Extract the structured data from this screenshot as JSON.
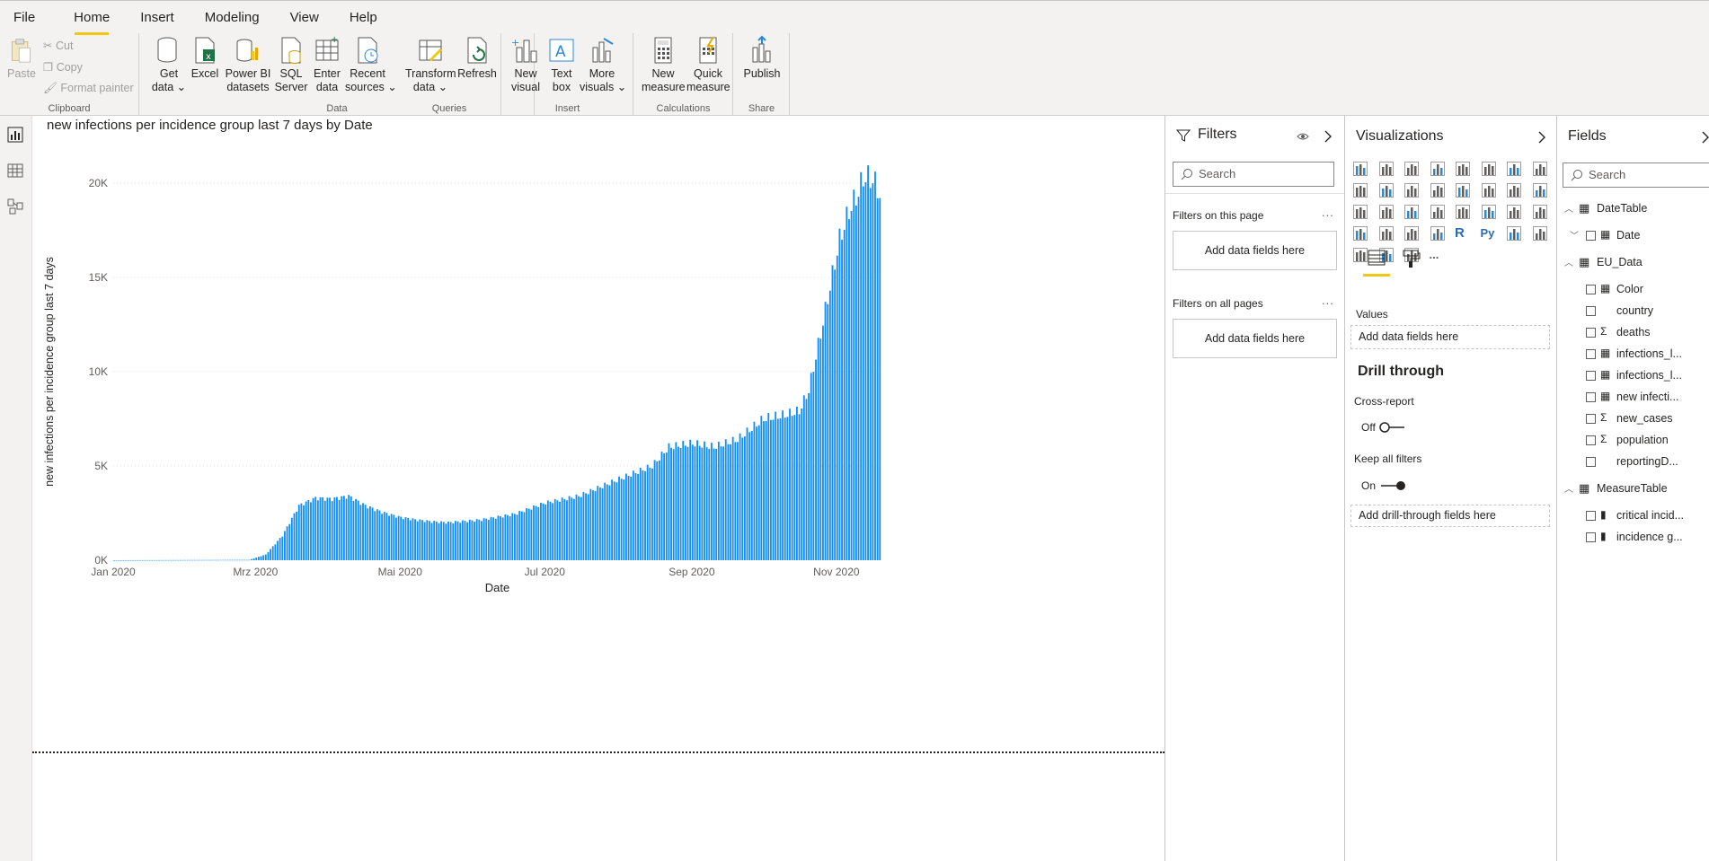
{
  "ribbon": {
    "tabs": [
      "File",
      "Home",
      "Insert",
      "Modeling",
      "View",
      "Help"
    ],
    "active_tab": "Home",
    "clipboard": {
      "paste": "Paste",
      "cut": "Cut",
      "copy": "Copy",
      "format_painter": "Format painter",
      "group": "Clipboard"
    },
    "data": {
      "get_data": [
        "Get",
        "data"
      ],
      "excel": [
        "Excel",
        ""
      ],
      "pbi_datasets": [
        "Power BI",
        "datasets"
      ],
      "sql_server": [
        "SQL",
        "Server"
      ],
      "enter_data": [
        "Enter",
        "data"
      ],
      "recent_sources": [
        "Recent",
        "sources"
      ],
      "group": "Data"
    },
    "queries": {
      "transform": [
        "Transform",
        "data"
      ],
      "refresh": [
        "Refresh",
        ""
      ],
      "group": "Queries"
    },
    "insert": {
      "new_visual": [
        "New",
        "visual"
      ],
      "text_box": [
        "Text",
        "box"
      ],
      "more_visuals": [
        "More",
        "visuals"
      ],
      "group": "Insert"
    },
    "calculations": {
      "new_measure": [
        "New",
        "measure"
      ],
      "quick_measure": [
        "Quick",
        "measure"
      ],
      "group": "Calculations"
    },
    "share": {
      "publish": [
        "Publish",
        ""
      ],
      "group": "Share"
    }
  },
  "visual": {
    "title": "new infections per incidence group last 7 days by Date"
  },
  "chart_data": {
    "type": "bar",
    "title": "new infections per incidence group last 7 days by Date",
    "xlabel": "Date",
    "ylabel": "new infections per incidence group last 7 days",
    "ylim": [
      0,
      20000
    ],
    "y_ticks": [
      "0K",
      "5K",
      "10K",
      "15K",
      "20K"
    ],
    "x_ticks": [
      "Jan 2020",
      "Mrz 2020",
      "Mai 2020",
      "Jul 2020",
      "Sep 2020",
      "Nov 2020"
    ],
    "x_start": "2020-01-01",
    "x_end": "2020-11-19",
    "color": "#118dff",
    "profile": [
      [
        "2020-01-01",
        0
      ],
      [
        "2020-02-27",
        20
      ],
      [
        "2020-03-05",
        300
      ],
      [
        "2020-03-12",
        1300
      ],
      [
        "2020-03-19",
        2900
      ],
      [
        "2020-03-26",
        3300
      ],
      [
        "2020-04-02",
        3250
      ],
      [
        "2020-04-09",
        3400
      ],
      [
        "2020-04-16",
        2900
      ],
      [
        "2020-04-23",
        2550
      ],
      [
        "2020-04-30",
        2300
      ],
      [
        "2020-05-07",
        2150
      ],
      [
        "2020-05-14",
        2050
      ],
      [
        "2020-05-21",
        2000
      ],
      [
        "2020-06-04",
        2150
      ],
      [
        "2020-06-18",
        2450
      ],
      [
        "2020-07-01",
        3050
      ],
      [
        "2020-07-15",
        3400
      ],
      [
        "2020-08-01",
        4300
      ],
      [
        "2020-08-15",
        5000
      ],
      [
        "2020-08-22",
        6000
      ],
      [
        "2020-09-01",
        6200
      ],
      [
        "2020-09-10",
        6000
      ],
      [
        "2020-09-20",
        6400
      ],
      [
        "2020-10-01",
        7500
      ],
      [
        "2020-10-10",
        7700
      ],
      [
        "2020-10-16",
        7900
      ],
      [
        "2020-10-20",
        9000
      ],
      [
        "2020-10-25",
        12000
      ],
      [
        "2020-10-29",
        14500
      ],
      [
        "2020-11-02",
        17000
      ],
      [
        "2020-11-06",
        18500
      ],
      [
        "2020-11-10",
        19500
      ],
      [
        "2020-11-12",
        20300
      ],
      [
        "2020-11-16",
        20200
      ],
      [
        "2020-11-19",
        19400
      ]
    ]
  },
  "filters": {
    "title": "Filters",
    "search_placeholder": "Search",
    "this_page": "Filters on this page",
    "all_pages": "Filters on all pages",
    "add_fields": "Add data fields here",
    "ellipsis": "..."
  },
  "visualizations": {
    "title": "Visualizations",
    "values_label": "Values",
    "values_well": "Add data fields here",
    "drill_through": "Drill through",
    "cross_report": "Cross-report",
    "cross_report_state": "Off",
    "keep_all_filters": "Keep all filters",
    "keep_all_filters_state": "On",
    "drill_well": "Add drill-through fields here",
    "r_label": "R",
    "py_label": "Py",
    "more": "..."
  },
  "fields": {
    "title": "Fields",
    "search_placeholder": "Search",
    "tables": [
      {
        "name": "DateTable",
        "items": [
          {
            "name": "Date",
            "kind": "hier"
          }
        ]
      },
      {
        "name": "EU_Data",
        "items": [
          {
            "name": "Color",
            "kind": "calc"
          },
          {
            "name": "country",
            "kind": "none"
          },
          {
            "name": "deaths",
            "kind": "sigma"
          },
          {
            "name": "infections_l...",
            "kind": "calc"
          },
          {
            "name": "infections_l...",
            "kind": "calc"
          },
          {
            "name": "new infecti...",
            "kind": "calc"
          },
          {
            "name": "new_cases",
            "kind": "sigma"
          },
          {
            "name": "population",
            "kind": "sigma"
          },
          {
            "name": "reportingD...",
            "kind": "none"
          }
        ]
      },
      {
        "name": "MeasureTable",
        "items": [
          {
            "name": "critical incid...",
            "kind": "measure"
          },
          {
            "name": "incidence g...",
            "kind": "measure"
          }
        ]
      }
    ]
  }
}
